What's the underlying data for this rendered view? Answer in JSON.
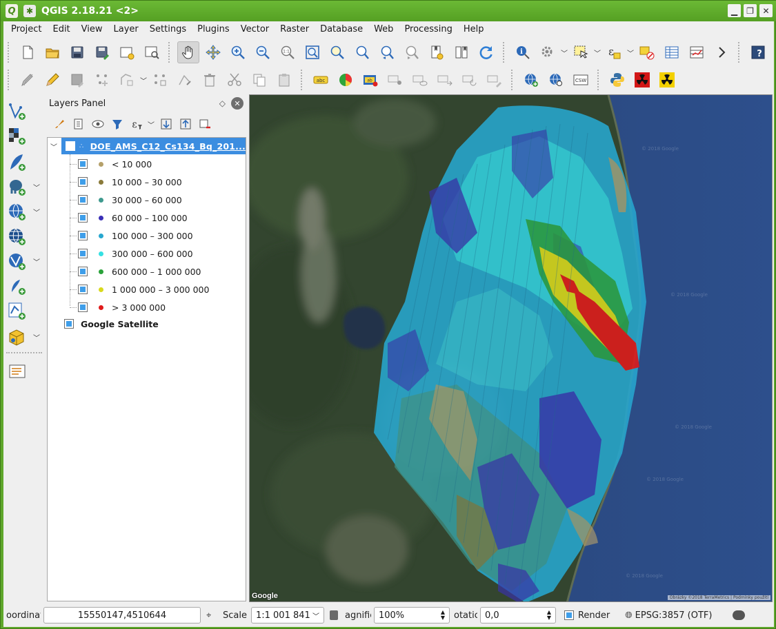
{
  "window": {
    "app_icon": "Q",
    "title": "QGIS 2.18.21 <2>"
  },
  "menu": [
    "Project",
    "Edit",
    "View",
    "Layer",
    "Settings",
    "Plugins",
    "Vector",
    "Raster",
    "Database",
    "Web",
    "Processing",
    "Help"
  ],
  "toolbar1": [
    {
      "name": "new-project-icon"
    },
    {
      "name": "open-project-icon"
    },
    {
      "name": "save-project-icon"
    },
    {
      "name": "save-as-icon"
    },
    {
      "name": "new-print-composer-icon"
    },
    {
      "name": "composer-manager-icon"
    },
    {
      "name": "pan-icon"
    },
    {
      "name": "pan-to-selection-icon"
    },
    {
      "name": "zoom-in-icon"
    },
    {
      "name": "zoom-out-icon"
    },
    {
      "name": "zoom-native-icon"
    },
    {
      "name": "zoom-full-icon"
    },
    {
      "name": "zoom-to-selection-icon"
    },
    {
      "name": "zoom-to-layer-icon"
    },
    {
      "name": "zoom-last-icon"
    },
    {
      "name": "zoom-next-icon"
    },
    {
      "name": "new-bookmark-icon"
    },
    {
      "name": "show-bookmarks-icon"
    },
    {
      "name": "refresh-icon"
    },
    {
      "name": "identify-icon"
    },
    {
      "name": "actions-icon"
    },
    {
      "name": "select-features-icon"
    },
    {
      "name": "select-by-expression-icon"
    },
    {
      "name": "deselect-icon"
    },
    {
      "name": "attribute-table-icon"
    },
    {
      "name": "field-calculator-icon"
    },
    {
      "name": "more-icon"
    },
    {
      "name": "help-icon"
    }
  ],
  "toolbar2_labels": {
    "label1": "abc",
    "label2": "ab",
    "csw": "CSW"
  },
  "zoom_native_label": "1:1",
  "layers_panel": {
    "title": "Layers Panel",
    "layer_group": "DOE_AMS_C12_Cs134_Bq_201...",
    "legend": [
      {
        "label": "< 10 000",
        "color": "#b5a06a"
      },
      {
        "label": "10 000 – 30 000",
        "color": "#8a7a3a"
      },
      {
        "label": "30 000 – 60 000",
        "color": "#3f9a8f"
      },
      {
        "label": "60 000 – 100 000",
        "color": "#3a2fb6"
      },
      {
        "label": "100 000 – 300 000",
        "color": "#27a7cf"
      },
      {
        "label": "300 000 – 600 000",
        "color": "#35e0e3"
      },
      {
        "label": "600 000 – 1 000 000",
        "color": "#2aa23a"
      },
      {
        "label": "1 000 000 – 3 000 000",
        "color": "#d9d91d"
      },
      {
        "label": "> 3 000 000",
        "color": "#e01b1b"
      }
    ],
    "basemap": "Google Satellite"
  },
  "map": {
    "google_label": "Google",
    "credit": "Obrázky ©2018 TerraMetrics | Podmínky použití"
  },
  "status": {
    "coord_label": "oordinat",
    "coord_value": "15550147,4510644",
    "scale_label": "Scale",
    "scale_value": "1:1 001 841",
    "magnifier_label": "agnifie",
    "magnifier_value": "100%",
    "rotation_label": "otatic",
    "rotation_value": "0,0",
    "render_label": "Render",
    "crs": "EPSG:3857 (OTF)"
  }
}
